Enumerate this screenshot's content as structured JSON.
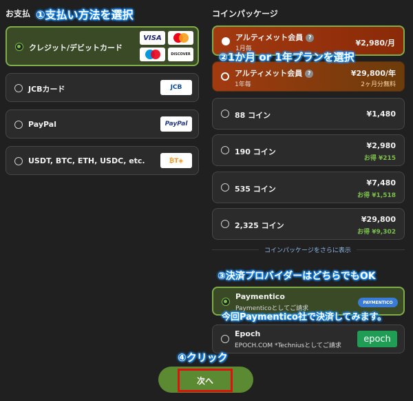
{
  "payment": {
    "title": "お支払",
    "options": [
      {
        "label": "クレジット/デビットカード",
        "selected": true
      },
      {
        "label": "JCBカード",
        "selected": false
      },
      {
        "label": "PayPal",
        "selected": false
      },
      {
        "label": "USDT, BTC, ETH, USDC, etc.",
        "selected": false
      }
    ],
    "logos": {
      "visa": "VISA",
      "discover": "DISCOVER",
      "jcb": "JCB",
      "paypal": "PayPal",
      "crypto": "₿T◈"
    }
  },
  "packages": {
    "title": "コインパッケージ",
    "ultimate_monthly": {
      "label": "アルティメット会員",
      "sub": "1月毎",
      "price": "¥2,980/月"
    },
    "ultimate_yearly": {
      "label": "アルティメット会員",
      "sub": "1年毎",
      "price": "¥29,800/年",
      "note": "2ヶ月分無料"
    },
    "coins": [
      {
        "label": "88 コイン",
        "price": "¥1,480",
        "saving": ""
      },
      {
        "label": "190 コイン",
        "price": "¥2,980",
        "saving": "お得 ¥215"
      },
      {
        "label": "535 コイン",
        "price": "¥7,480",
        "saving": "お得 ¥1,518"
      },
      {
        "label": "2,325 コイン",
        "price": "¥29,800",
        "saving": "お得 ¥9,302"
      }
    ],
    "more_link": "コインパッケージをさらに表示"
  },
  "providers": {
    "paymentico": {
      "name": "Paymentico",
      "sub": "Paymenticoとしてご請求",
      "logo": "PAYMENTICO"
    },
    "epoch": {
      "name": "Epoch",
      "sub": "EPOCH.COM *Techniusとしてご請求",
      "logo": "epoch"
    }
  },
  "next_label": "次へ",
  "annotations": {
    "a1": "①支払い方法を選択",
    "a2": "②1か月 or 1年プランを選択",
    "a3": "③決済プロバイダーはどちらでもOK",
    "a3b": "今回Paymentico社で決済してみます。",
    "a4": "④クリック"
  },
  "colors": {
    "accent_green": "#77c04a",
    "highlight_border": "#e01010",
    "annotation_glow": "#1e90ff"
  }
}
